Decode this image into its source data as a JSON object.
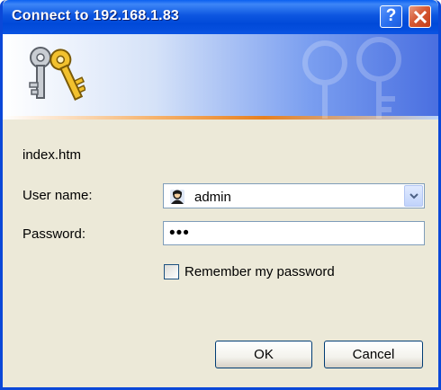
{
  "window": {
    "title": "Connect to 192.168.1.83",
    "help_glyph": "?",
    "close_glyph": "×"
  },
  "banner": {
    "icon": "keys-icon"
  },
  "form": {
    "resource": "index.htm",
    "username_label": "User name:",
    "username_value": "admin",
    "password_label": "Password:",
    "password_mask": "•••",
    "remember_label": "Remember my password",
    "remember_checked": false
  },
  "buttons": {
    "ok": "OK",
    "cancel": "Cancel"
  },
  "colors": {
    "titlebar": "#0049d8",
    "dialog_bg": "#ece9d8",
    "banner_accent": "#e8801e",
    "close_button": "#c43c17"
  }
}
